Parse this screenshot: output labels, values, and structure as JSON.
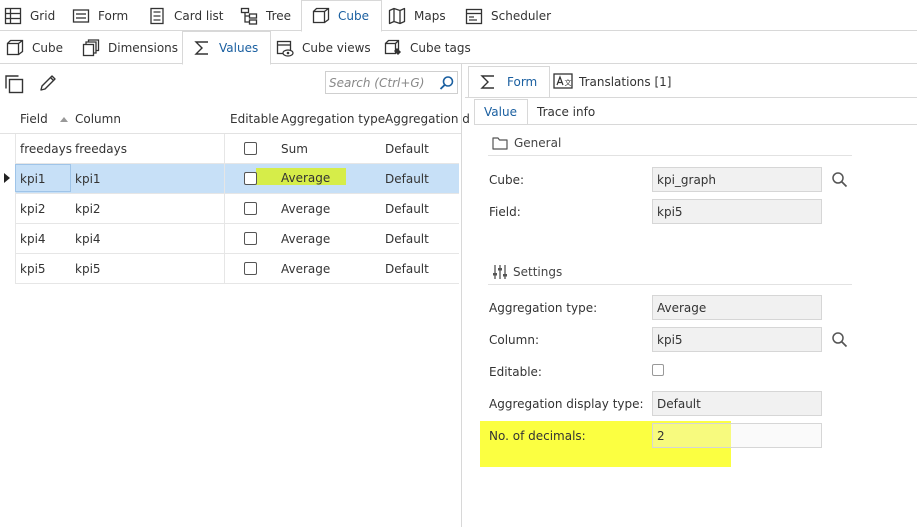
{
  "top_tabs": [
    {
      "label": "Grid",
      "icon": "grid-icon"
    },
    {
      "label": "Form",
      "icon": "form-icon"
    },
    {
      "label": "Card list",
      "icon": "card-list-icon"
    },
    {
      "label": "Tree",
      "icon": "tree-icon"
    },
    {
      "label": "Cube",
      "icon": "cube-icon",
      "active": true
    },
    {
      "label": "Maps",
      "icon": "map-icon"
    },
    {
      "label": "Scheduler",
      "icon": "scheduler-icon"
    }
  ],
  "sub_tabs": [
    {
      "label": "Cube",
      "icon": "cube-icon"
    },
    {
      "label": "Dimensions",
      "icon": "dimensions-icon"
    },
    {
      "label": "Values",
      "icon": "sigma-icon",
      "active": true
    },
    {
      "label": "Cube views",
      "icon": "cube-views-icon"
    },
    {
      "label": "Cube tags",
      "icon": "cube-tags-icon"
    }
  ],
  "toolbar": {
    "search_placeholder": "Search (Ctrl+G)"
  },
  "grid": {
    "columns": [
      "Field",
      "Column",
      "Editable",
      "Aggregation type",
      "Aggregation d"
    ],
    "rows": [
      {
        "field": "freedays",
        "column": "freedays",
        "editable": false,
        "agg_type": "Sum",
        "agg_display": "Default"
      },
      {
        "field": "kpi1",
        "column": "kpi1",
        "editable": false,
        "agg_type": "Average",
        "agg_display": "Default",
        "selected": true
      },
      {
        "field": "kpi2",
        "column": "kpi2",
        "editable": false,
        "agg_type": "Average",
        "agg_display": "Default"
      },
      {
        "field": "kpi4",
        "column": "kpi4",
        "editable": false,
        "agg_type": "Average",
        "agg_display": "Default"
      },
      {
        "field": "kpi5",
        "column": "kpi5",
        "editable": false,
        "agg_type": "Average",
        "agg_display": "Default"
      }
    ]
  },
  "right_panel": {
    "tabs": [
      {
        "label": "Form",
        "icon": "sigma-icon",
        "active": true
      },
      {
        "label": "Translations [1]",
        "icon": "translate-icon"
      }
    ],
    "subtabs": [
      {
        "label": "Value",
        "active": true
      },
      {
        "label": "Trace info"
      }
    ],
    "general": {
      "title": "General",
      "cube_label": "Cube:",
      "cube_value": "kpi_graph",
      "field_label": "Field:",
      "field_value": "kpi5"
    },
    "settings": {
      "title": "Settings",
      "agg_type_label": "Aggregation type:",
      "agg_type_value": "Average",
      "column_label": "Column:",
      "column_value": "kpi5",
      "editable_label": "Editable:",
      "agg_display_label": "Aggregation display type:",
      "agg_display_value": "Default",
      "decimals_label": "No. of decimals:",
      "decimals_value": "2"
    }
  },
  "colors": {
    "accent": "#1a5fa0",
    "selection": "#c7e0f7",
    "highlight_green": "#d8ee2a",
    "highlight_yellow": "#fbff2c"
  }
}
